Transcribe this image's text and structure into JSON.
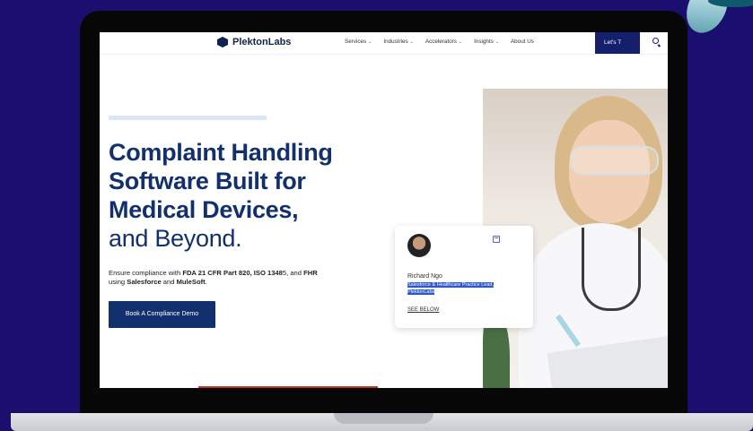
{
  "nav": {
    "brand": "PlektonLabs",
    "items": [
      {
        "label": "Services",
        "dropdown": true
      },
      {
        "label": "Industries",
        "dropdown": true
      },
      {
        "label": "Accelerators",
        "dropdown": true
      },
      {
        "label": "Insights",
        "dropdown": true
      },
      {
        "label": "About Us",
        "dropdown": false
      }
    ],
    "cta_label": "Let's T",
    "search_icon": "search-icon"
  },
  "hero": {
    "heading_lines": [
      "Complaint Handling",
      "Software Built for",
      "Medical Devices,"
    ],
    "heading_light": "and Beyond.",
    "subtext_parts": [
      {
        "text": "Ensure compliance with ",
        "bold": false
      },
      {
        "text": "FDA 21 CFR Part 820, ISO 1348",
        "bold": true
      },
      {
        "text": "5, and ",
        "bold": false
      },
      {
        "text": "FHR",
        "bold": true
      },
      {
        "text": " using ",
        "bold": false
      },
      {
        "text": "Salesforce",
        "bold": true
      },
      {
        "text": " and ",
        "bold": false
      },
      {
        "text": "MuleSoft",
        "bold": true
      },
      {
        "text": ".",
        "bold": false
      }
    ],
    "demo_button": "Book A Compliance Demo"
  },
  "card": {
    "name": "Richard Ngo",
    "role": "Salesforce & Healthcare Practice Lead, PlektonLabs",
    "link": "SEE BELOW"
  },
  "colors": {
    "background": "#1a0f6e",
    "brand_navy": "#12306e",
    "highlight": "#2b58d8"
  }
}
